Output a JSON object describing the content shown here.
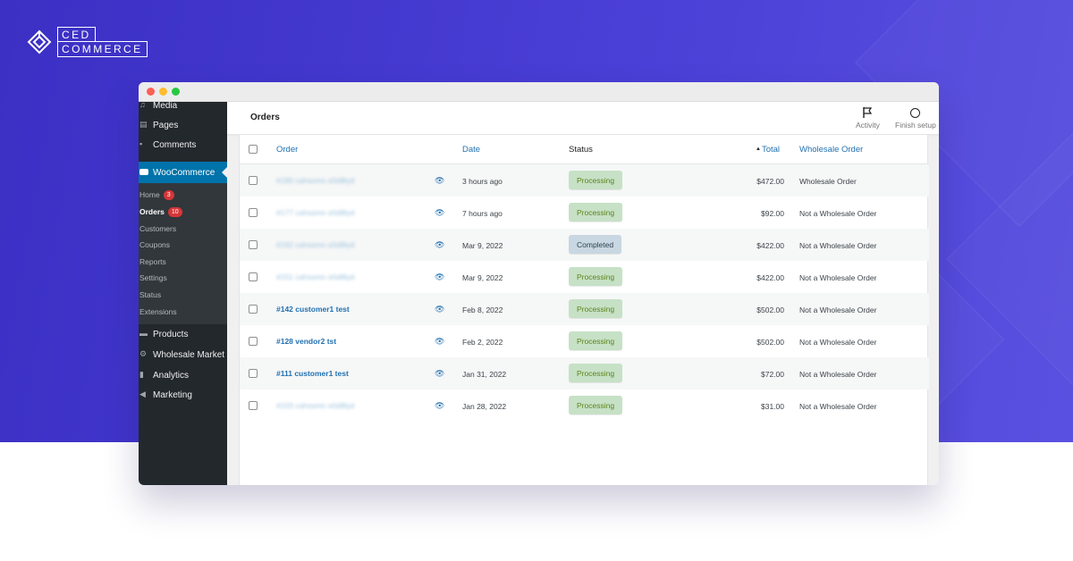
{
  "brand": {
    "line1": "CED",
    "line2": "COMMERCE"
  },
  "colors": {
    "background": "#4337cf",
    "accent": "#2271b1",
    "sidebar": "#23282d",
    "woo_active": "#0073aa",
    "processing_bg": "#c6e1c6",
    "completed_bg": "#c8d7e1"
  },
  "sidebar": {
    "top_items": [
      {
        "label": "Media",
        "icon": "media-icon"
      },
      {
        "label": "Pages",
        "icon": "pages-icon"
      },
      {
        "label": "Comments",
        "icon": "comments-icon"
      }
    ],
    "woocommerce": {
      "label": "WooCommerce",
      "icon": "woo-icon"
    },
    "submenu": [
      {
        "label": "Home",
        "badge": "3"
      },
      {
        "label": "Orders",
        "badge": "10"
      },
      {
        "label": "Customers"
      },
      {
        "label": "Coupons"
      },
      {
        "label": "Reports"
      },
      {
        "label": "Settings"
      },
      {
        "label": "Status"
      },
      {
        "label": "Extensions"
      }
    ],
    "bottom_items": [
      {
        "label": "Products",
        "icon": "products-icon"
      },
      {
        "label": "Wholesale Market",
        "icon": "gear-icon"
      },
      {
        "label": "Analytics",
        "icon": "analytics-icon"
      },
      {
        "label": "Marketing",
        "icon": "megaphone-icon"
      }
    ]
  },
  "header": {
    "title": "Orders",
    "activity_label": "Activity",
    "finish_setup_label": "Finish setup"
  },
  "table": {
    "columns": {
      "order": "Order",
      "date": "Date",
      "status": "Status",
      "total": "Total",
      "wholesale": "Wholesale Order"
    },
    "sort_indicator": "▲",
    "rows": [
      {
        "order": "#180 cahssmo o0d8lyd",
        "blurred": true,
        "date": "3 hours ago",
        "status": "Processing",
        "total": "$472.00",
        "wholesale": "Wholesale Order"
      },
      {
        "order": "#177 cahssmo o0d8lyd",
        "blurred": true,
        "date": "7 hours ago",
        "status": "Processing",
        "total": "$92.00",
        "wholesale": "Not a Wholesale Order"
      },
      {
        "order": "#162 cahssmo o0d8lyd",
        "blurred": true,
        "date": "Mar 9, 2022",
        "status": "Completed",
        "total": "$422.00",
        "wholesale": "Not a Wholesale Order"
      },
      {
        "order": "#151 cahssmo o0d8lyd",
        "blurred": true,
        "date": "Mar 9, 2022",
        "status": "Processing",
        "total": "$422.00",
        "wholesale": "Not a Wholesale Order"
      },
      {
        "order": "#142 customer1 test",
        "blurred": false,
        "date": "Feb 8, 2022",
        "status": "Processing",
        "total": "$502.00",
        "wholesale": "Not a Wholesale Order"
      },
      {
        "order": "#128 vendor2 tst",
        "blurred": false,
        "date": "Feb 2, 2022",
        "status": "Processing",
        "total": "$502.00",
        "wholesale": "Not a Wholesale Order"
      },
      {
        "order": "#111 customer1 test",
        "blurred": false,
        "date": "Jan 31, 2022",
        "status": "Processing",
        "total": "$72.00",
        "wholesale": "Not a Wholesale Order"
      },
      {
        "order": "#103 cahssmo o0d8lyd",
        "blurred": true,
        "date": "Jan 28, 2022",
        "status": "Processing",
        "total": "$31.00",
        "wholesale": "Not a Wholesale Order"
      }
    ]
  }
}
